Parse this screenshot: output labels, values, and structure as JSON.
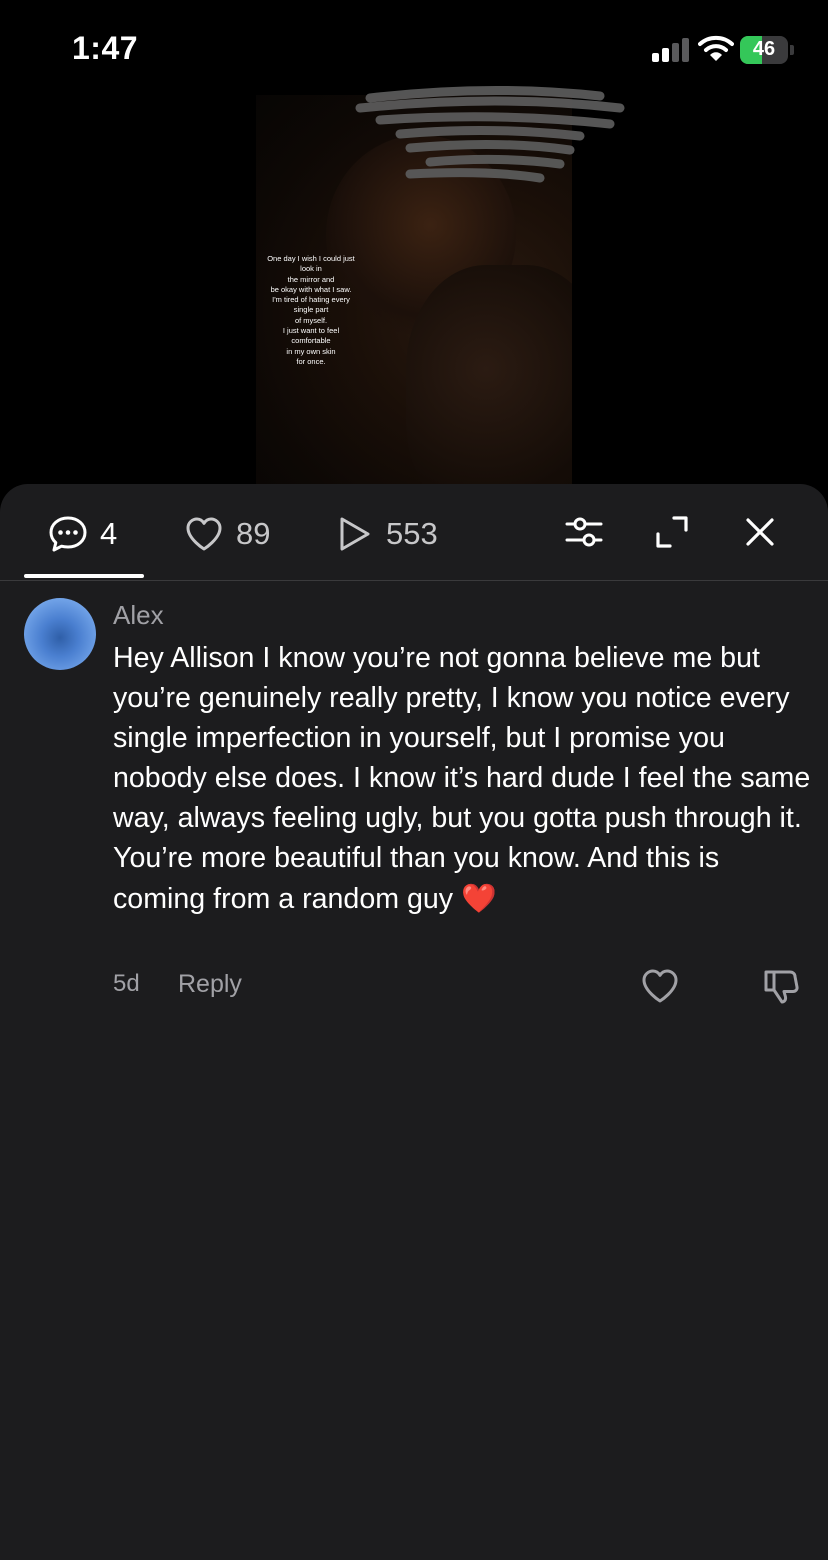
{
  "status_bar": {
    "time": "1:47",
    "battery_level": "46",
    "battery_fraction": 0.46
  },
  "video": {
    "overlay_text": "One day I wish I could just\nlook in\nthe mirror and\nbe okay with what I saw.\nI'm tired of hating every\nsingle part\nof myself.\nI just want to feel\ncomfortable\nin my own skin\nfor once."
  },
  "tabs": {
    "comments": {
      "icon": "comment-icon",
      "count": "4"
    },
    "likes": {
      "icon": "heart-outline-icon",
      "count": "89"
    },
    "plays": {
      "icon": "play-icon",
      "count": "553"
    }
  },
  "toolbar": {
    "filter_icon": "sliders-icon",
    "expand_icon": "expand-icon",
    "close_icon": "close-icon"
  },
  "comment": {
    "username": "Alex",
    "text": "Hey Allison I know you’re not gonna believe me but you’re genuinely really pretty, I know you notice every single imperfection in yourself, but I promise you nobody else does. I know it’s hard dude I feel the same way, always feeling ugly, but you gotta push through it. You’re more beautiful than you know. And this is coming from a random guy ",
    "emoji": "❤️",
    "age": "5d",
    "reply_label": "Reply"
  },
  "colors": {
    "panel": "#1c1c1e",
    "secondary_text": "#a1a1a6",
    "battery_green": "#34c759",
    "emoji_red": "#ff1f3d"
  }
}
